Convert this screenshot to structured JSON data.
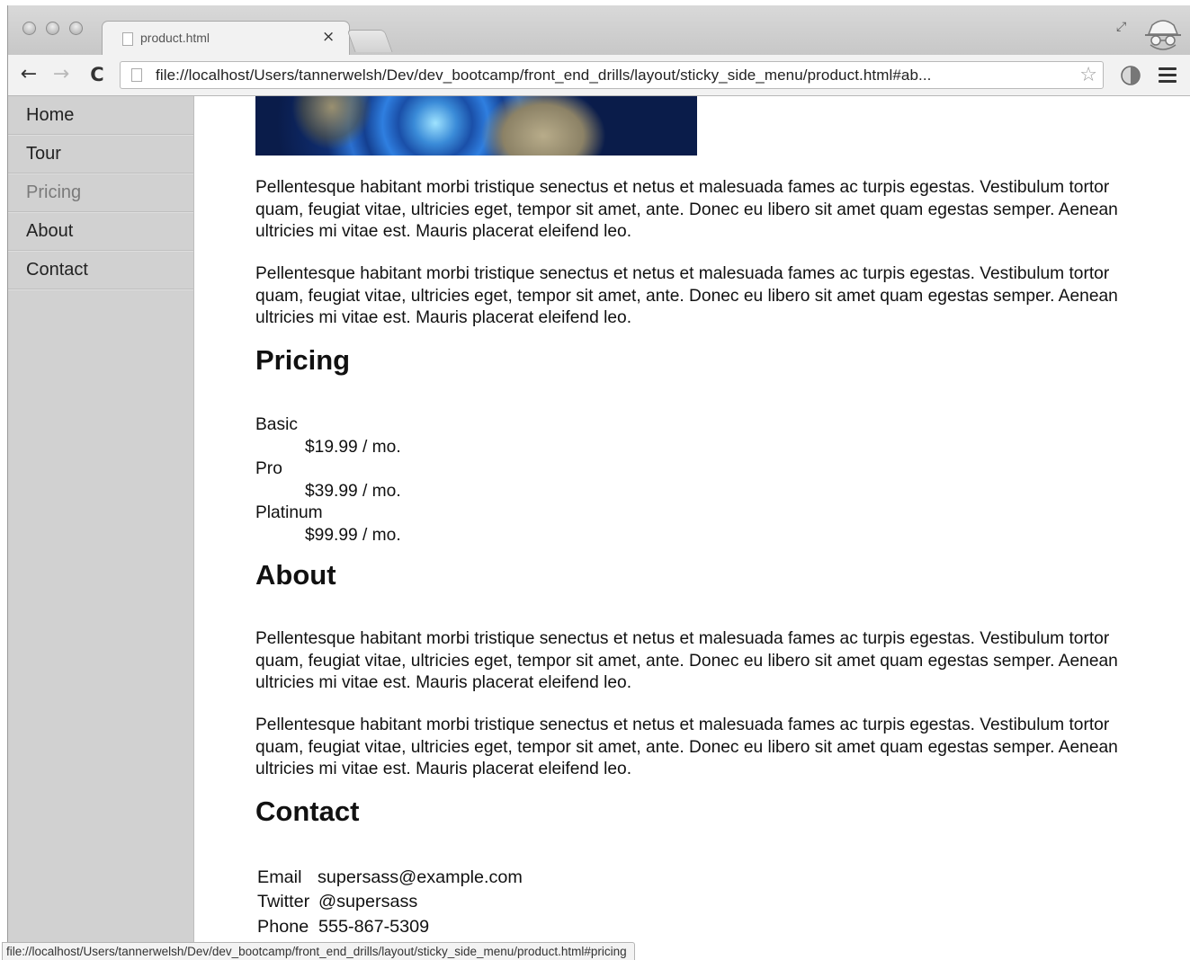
{
  "browser": {
    "tab_title": "product.html",
    "tab_close": "×",
    "url": "file://localhost/Users/tannerwelsh/Dev/dev_bootcamp/front_end_drills/layout/sticky_side_menu/product.html#ab...",
    "status_url": "file://localhost/Users/tannerwelsh/Dev/dev_bootcamp/front_end_drills/layout/sticky_side_menu/product.html#pricing",
    "icons": {
      "back": "←",
      "forward": "→",
      "reload": "C",
      "star": "☆",
      "fullscreen": "⤢"
    }
  },
  "sidebar": {
    "items": [
      {
        "label": "Home"
      },
      {
        "label": "Tour"
      },
      {
        "label": "Pricing",
        "active": true
      },
      {
        "label": "About"
      },
      {
        "label": "Contact"
      }
    ]
  },
  "content": {
    "intro_paragraphs": [
      "Pellentesque habitant morbi tristique senectus et netus et malesuada fames ac turpis egestas. Vestibulum tortor quam, feugiat vitae, ultricies eget, tempor sit amet, ante. Donec eu libero sit amet quam egestas semper. Aenean ultricies mi vitae est. Mauris placerat eleifend leo.",
      "Pellentesque habitant morbi tristique senectus et netus et malesuada fames ac turpis egestas. Vestibulum tortor quam, feugiat vitae, ultricies eget, tempor sit amet, ante. Donec eu libero sit amet quam egestas semper. Aenean ultricies mi vitae est. Mauris placerat eleifend leo."
    ],
    "pricing": {
      "heading": "Pricing",
      "plans": [
        {
          "name": "Basic",
          "price": "$19.99 / mo."
        },
        {
          "name": "Pro",
          "price": "$39.99 / mo."
        },
        {
          "name": "Platinum",
          "price": "$99.99 / mo."
        }
      ]
    },
    "about": {
      "heading": "About",
      "paragraphs": [
        "Pellentesque habitant morbi tristique senectus et netus et malesuada fames ac turpis egestas. Vestibulum tortor quam, feugiat vitae, ultricies eget, tempor sit amet, ante. Donec eu libero sit amet quam egestas semper. Aenean ultricies mi vitae est. Mauris placerat eleifend leo.",
        "Pellentesque habitant morbi tristique senectus et netus et malesuada fames ac turpis egestas. Vestibulum tortor quam, feugiat vitae, ultricies eget, tempor sit amet, ante. Donec eu libero sit amet quam egestas semper. Aenean ultricies mi vitae est. Mauris placerat eleifend leo."
      ]
    },
    "contact": {
      "heading": "Contact",
      "rows": [
        {
          "label": "Email",
          "value": "supersass@example.com"
        },
        {
          "label": "Twitter",
          "value": "@supersass"
        },
        {
          "label": "Phone",
          "value": "555-867-5309"
        }
      ]
    }
  }
}
